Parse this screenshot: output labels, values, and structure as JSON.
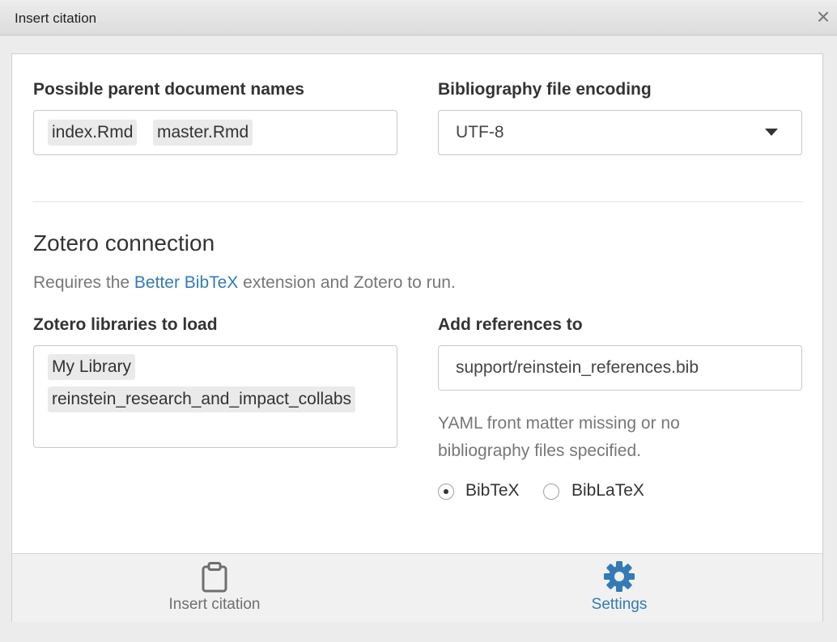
{
  "dialog": {
    "title": "Insert citation",
    "close_glyph": "×"
  },
  "parent_docs": {
    "label": "Possible parent document names",
    "chips": [
      "index.Rmd",
      "master.Rmd"
    ]
  },
  "encoding": {
    "label": "Bibliography file encoding",
    "value": "UTF-8"
  },
  "zotero": {
    "heading": "Zotero connection",
    "help_prefix": "Requires the ",
    "help_link": "Better BibTeX",
    "help_suffix": " extension and Zotero to run.",
    "libraries_label": "Zotero libraries to load",
    "libraries": [
      "My Library",
      "reinstein_research_and_impact_collabs"
    ]
  },
  "references": {
    "label": "Add references to",
    "value": "support/reinstein_references.bib",
    "warning": "YAML front matter missing or no bibliography files specified.",
    "format_options": [
      {
        "label": "BibTeX",
        "selected": true
      },
      {
        "label": "BibLaTeX",
        "selected": false
      }
    ]
  },
  "footer": {
    "tabs": [
      {
        "label": "Insert citation",
        "icon": "clipboard-icon",
        "active": false
      },
      {
        "label": "Settings",
        "icon": "gear-icon",
        "active": true
      }
    ]
  },
  "colors": {
    "accent": "#337ab7",
    "inactive_tab": "#6f6f6f",
    "chip_bg": "#eaeaea"
  }
}
